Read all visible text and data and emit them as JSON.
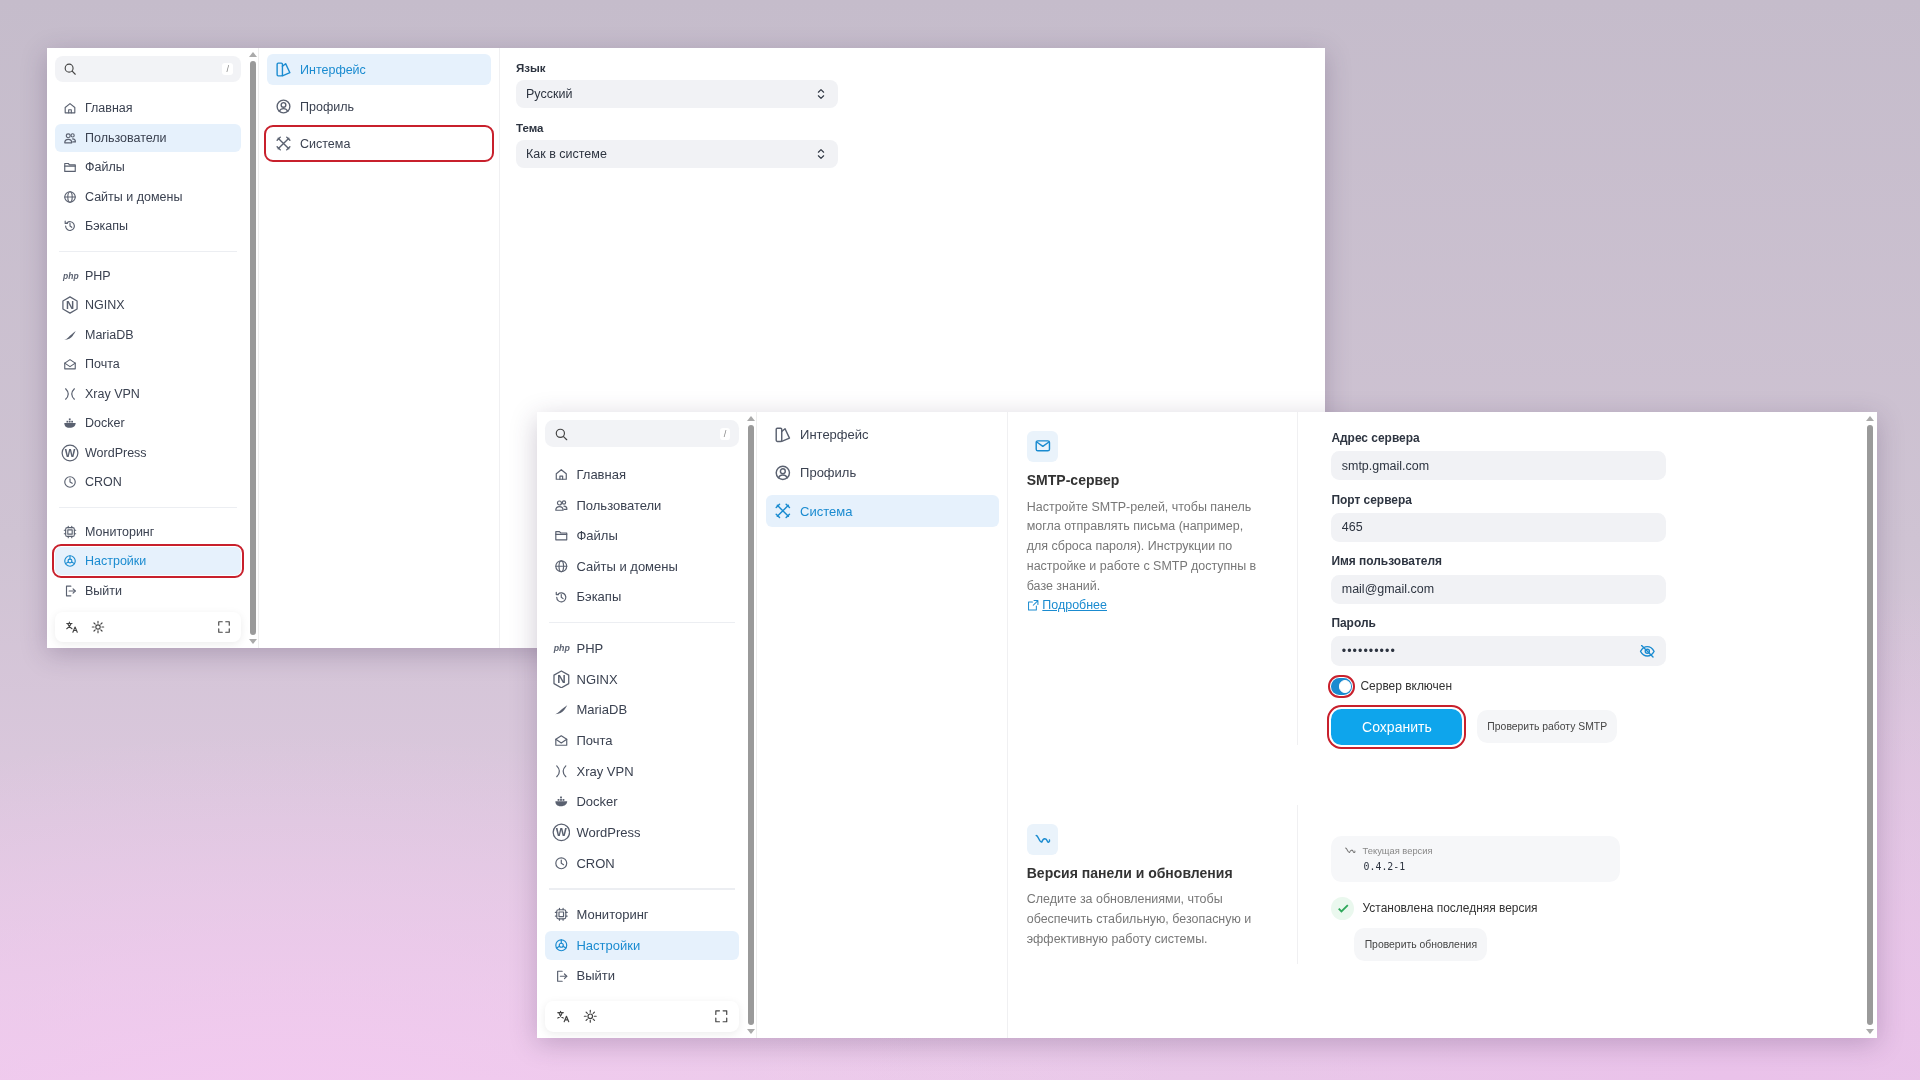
{
  "windows": [
    {
      "sidebar": {
        "search_shortcut": "/",
        "groups": [
          [
            {
              "label": "Главная",
              "selected": false,
              "hovered": false,
              "outlined": false
            },
            {
              "label": "Пользователи",
              "selected": false,
              "hovered": true,
              "outlined": false
            },
            {
              "label": "Файлы",
              "selected": false,
              "hovered": false,
              "outlined": false
            },
            {
              "label": "Сайты и домены",
              "selected": false,
              "hovered": false,
              "outlined": false
            },
            {
              "label": "Бэкапы",
              "selected": false,
              "hovered": false,
              "outlined": false
            }
          ],
          [
            {
              "label": "PHP",
              "icon_label": "php",
              "selected": false,
              "hovered": false,
              "outlined": false
            },
            {
              "label": "NGINX",
              "icon_label": "N",
              "selected": false,
              "hovered": false,
              "outlined": false
            },
            {
              "label": "MariaDB",
              "selected": false,
              "hovered": false,
              "outlined": false
            },
            {
              "label": "Почта",
              "selected": false,
              "hovered": false,
              "outlined": false
            },
            {
              "label": "Xray VPN",
              "selected": false,
              "hovered": false,
              "outlined": false
            },
            {
              "label": "Docker",
              "selected": false,
              "hovered": false,
              "outlined": false
            },
            {
              "label": "WordPress",
              "icon_label": "W",
              "selected": false,
              "hovered": false,
              "outlined": false
            },
            {
              "label": "CRON",
              "selected": false,
              "hovered": false,
              "outlined": false
            }
          ],
          [
            {
              "label": "Мониторинг",
              "selected": false,
              "hovered": false,
              "outlined": false
            },
            {
              "label": "Настройки",
              "selected": true,
              "hovered": false,
              "outlined": true
            },
            {
              "label": "Выйти",
              "selected": false,
              "hovered": false,
              "outlined": false
            }
          ]
        ]
      },
      "submenu": [
        {
          "label": "Интерфейс",
          "selected": true,
          "outlined": false
        },
        {
          "label": "Профиль",
          "selected": false,
          "outlined": false
        },
        {
          "label": "Система",
          "selected": false,
          "outlined": true
        }
      ],
      "content": {
        "kind": "interface",
        "fields": [
          {
            "label": "Язык",
            "value": "Русский"
          },
          {
            "label": "Тема",
            "value": "Как в системе"
          }
        ]
      }
    },
    {
      "sidebar": {
        "search_shortcut": "/",
        "groups": [
          [
            {
              "label": "Главная",
              "selected": false,
              "hovered": false,
              "outlined": false
            },
            {
              "label": "Пользователи",
              "selected": false,
              "hovered": false,
              "outlined": false
            },
            {
              "label": "Файлы",
              "selected": false,
              "hovered": false,
              "outlined": false
            },
            {
              "label": "Сайты и домены",
              "selected": false,
              "hovered": false,
              "outlined": false
            },
            {
              "label": "Бэкапы",
              "selected": false,
              "hovered": false,
              "outlined": false
            }
          ],
          [
            {
              "label": "PHP",
              "icon_label": "php",
              "selected": false,
              "hovered": false,
              "outlined": false
            },
            {
              "label": "NGINX",
              "icon_label": "N",
              "selected": false,
              "hovered": false,
              "outlined": false
            },
            {
              "label": "MariaDB",
              "selected": false,
              "hovered": false,
              "outlined": false
            },
            {
              "label": "Почта",
              "selected": false,
              "hovered": false,
              "outlined": false
            },
            {
              "label": "Xray VPN",
              "selected": false,
              "hovered": false,
              "outlined": false
            },
            {
              "label": "Docker",
              "selected": false,
              "hovered": false,
              "outlined": false
            },
            {
              "label": "WordPress",
              "icon_label": "W",
              "selected": false,
              "hovered": false,
              "outlined": false
            },
            {
              "label": "CRON",
              "selected": false,
              "hovered": false,
              "outlined": false
            }
          ],
          [
            {
              "label": "Мониторинг",
              "selected": false,
              "hovered": false,
              "outlined": false
            },
            {
              "label": "Настройки",
              "selected": true,
              "hovered": false,
              "outlined": false
            },
            {
              "label": "Выйти",
              "selected": false,
              "hovered": false,
              "outlined": false
            }
          ]
        ]
      },
      "submenu": [
        {
          "label": "Интерфейс",
          "selected": false,
          "outlined": false
        },
        {
          "label": "Профиль",
          "selected": false,
          "outlined": false
        },
        {
          "label": "Система",
          "selected": true,
          "outlined": false
        }
      ],
      "content": {
        "kind": "system",
        "sections": [
          {
            "kind": "smtp",
            "title": "SMTP-сервер",
            "description": "Настройте SMTP-релей, чтобы панель могла отправлять письма (например, для сброса пароля). Инструкции по настройке и работе с SMTP доступны в базе знаний.",
            "link": "Подробнее",
            "fields": [
              {
                "label": "Адрес сервера",
                "value": "smtp.gmail.com",
                "kind": "text"
              },
              {
                "label": "Порт сервера",
                "value": "465",
                "kind": "text"
              },
              {
                "label": "Имя пользователя",
                "value": "mail@gmail.com",
                "kind": "text"
              },
              {
                "label": "Пароль",
                "value": "••••••••••",
                "kind": "password"
              }
            ],
            "toggle": {
              "label": "Сервер включен",
              "on": true,
              "outlined": true
            },
            "buttons": [
              {
                "label": "Сохранить",
                "kind": "primary",
                "outlined": true
              },
              {
                "label": "Проверить работу SMTP",
                "kind": "secondary",
                "outlined": false
              }
            ]
          },
          {
            "kind": "version",
            "title": "Версия панели и обновления",
            "description": "Следите за обновлениями, чтобы обеспечить стабильную, безопасную и эффективную работу системы.",
            "version_label": "Текущая версия",
            "version": "0.4.2-1",
            "status": "Установлена последняя версия",
            "button": "Проверить обновления"
          }
        ]
      }
    }
  ]
}
